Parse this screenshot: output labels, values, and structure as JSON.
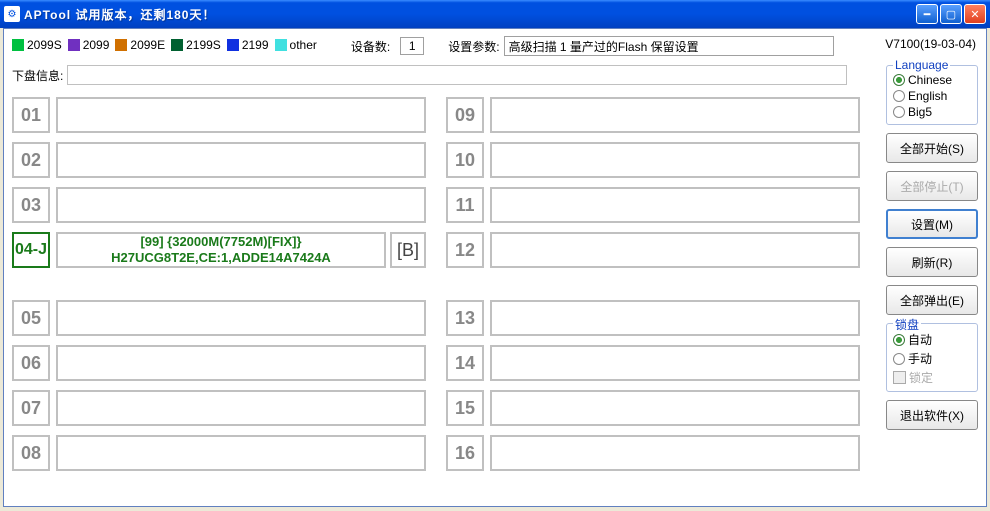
{
  "window": {
    "title": "APTool  试用版本，还剩180天！"
  },
  "legend": [
    {
      "label": "2099S",
      "color": "#00c040"
    },
    {
      "label": "2099",
      "color": "#7030c0"
    },
    {
      "label": "2099E",
      "color": "#d07000"
    },
    {
      "label": "2199S",
      "color": "#006030"
    },
    {
      "label": "2199",
      "color": "#1030e0"
    },
    {
      "label": "other",
      "color": "#40e0e0"
    }
  ],
  "labels": {
    "device_count": "设备数:",
    "device_count_value": "1",
    "set_params": "设置参数:",
    "params_value": "高级扫描 1 量产过的Flash 保留设置",
    "version": "V7100(19-03-04)",
    "disk_info": "下盘信息:"
  },
  "slots_left": [
    {
      "id": "01"
    },
    {
      "id": "02"
    },
    {
      "id": "03"
    },
    {
      "id": "04-J",
      "active": true,
      "line1": "[99] {32000M(7752M)[FIX]}",
      "line2": "H27UCG8T2E,CE:1,ADDE14A7424A",
      "suffix": "[B]"
    },
    {
      "id": "05"
    },
    {
      "id": "06"
    },
    {
      "id": "07"
    },
    {
      "id": "08"
    }
  ],
  "slots_right": [
    {
      "id": "09"
    },
    {
      "id": "10"
    },
    {
      "id": "11"
    },
    {
      "id": "12"
    },
    {
      "id": "13"
    },
    {
      "id": "14"
    },
    {
      "id": "15"
    },
    {
      "id": "16"
    }
  ],
  "language": {
    "title": "Language",
    "options": [
      "Chinese",
      "English",
      "Big5"
    ],
    "selected": "Chinese"
  },
  "lockdisk": {
    "title": "锁盘",
    "options": [
      "自动",
      "手动"
    ],
    "selected": "自动",
    "lock_label": "锁定"
  },
  "buttons": {
    "start_all": "全部开始(S)",
    "stop_all": "全部停止(T)",
    "settings": "设置(M)",
    "refresh": "刷新(R)",
    "eject_all": "全部弹出(E)",
    "exit": "退出软件(X)"
  }
}
